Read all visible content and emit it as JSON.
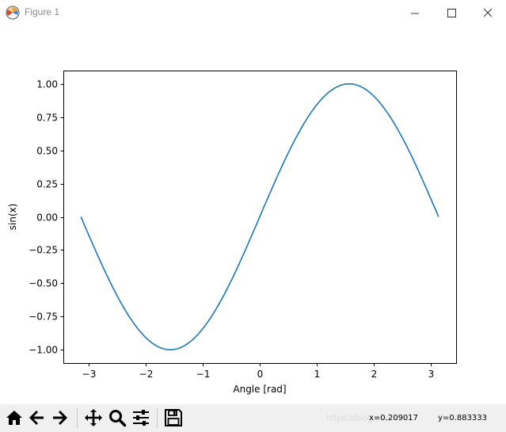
{
  "window": {
    "title": "Figure 1",
    "icon": "matplotlib-logo-icon",
    "controls": [
      "minimize-icon",
      "maximize-icon",
      "close-icon"
    ]
  },
  "chart_data": {
    "type": "line",
    "title": "",
    "xlabel": "Angle [rad]",
    "ylabel": "sin(x)",
    "xlim": [
      -3.45,
      3.45
    ],
    "ylim": [
      -1.1,
      1.1
    ],
    "xticks": [
      -3,
      -2,
      -1,
      0,
      1,
      2,
      3
    ],
    "xtick_labels": [
      "−3",
      "−2",
      "−1",
      "0",
      "1",
      "2",
      "3"
    ],
    "yticks": [
      1.0,
      0.75,
      0.5,
      0.25,
      0.0,
      -0.25,
      -0.5,
      -0.75,
      -1.0
    ],
    "ytick_labels": [
      "1.00",
      "0.75",
      "0.50",
      "0.25",
      "0.00",
      "−0.25",
      "−0.50",
      "−0.75",
      "−1.00"
    ],
    "grid": false,
    "legend": "none",
    "series": [
      {
        "color": "#1f77b4",
        "function": "sin(x)",
        "x": [
          -3.1416,
          -2.7489,
          -2.3562,
          -1.9635,
          -1.5708,
          -1.1781,
          -0.7854,
          -0.3927,
          0.0,
          0.3927,
          0.7854,
          1.1781,
          1.5708,
          1.9635,
          2.3562,
          2.7489,
          3.1416
        ],
        "y": [
          0.0,
          -0.3827,
          -0.7071,
          -0.9239,
          -1.0,
          -0.9239,
          -0.7071,
          -0.3827,
          0.0,
          0.3827,
          0.7071,
          0.9239,
          1.0,
          0.9239,
          0.7071,
          0.3827,
          0.0
        ]
      }
    ]
  },
  "toolbar": {
    "buttons": [
      {
        "name": "home-icon"
      },
      {
        "name": "back-arrow-icon"
      },
      {
        "name": "forward-arrow-icon"
      },
      {
        "name": "pan-icon"
      },
      {
        "name": "zoom-icon"
      },
      {
        "name": "configure-subplots-icon"
      },
      {
        "name": "save-icon"
      }
    ],
    "x_readout": "x=0.209017",
    "y_readout": "y=0.883333",
    "watermark": "https://blog.csdn.net"
  }
}
